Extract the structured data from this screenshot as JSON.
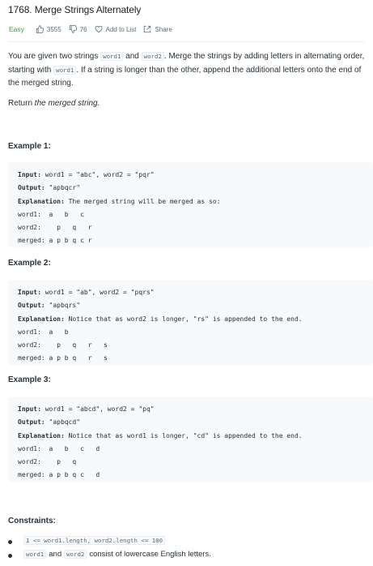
{
  "problem": {
    "title": "1768. Merge Strings Alternately",
    "difficulty": "Easy",
    "likes": "3555",
    "dislikes": "76",
    "add_to_list": "Add to List",
    "share": "Share"
  },
  "description": {
    "p1_a": "You are given two strings ",
    "p1_code1": "word1",
    "p1_b": " and ",
    "p1_code2": "word2",
    "p1_c": ". Merge the strings by adding letters in alternating order, starting with ",
    "p1_code3": "word1",
    "p1_d": ". If a string is longer than the other, append the additional letters onto the end of the merged string.",
    "p2_a": "Return ",
    "p2_em": "the merged string."
  },
  "examples": [
    {
      "title": "Example 1:",
      "input_label": "Input:",
      "input": " word1 = \"abc\", word2 = \"pqr\"",
      "output_label": "Output:",
      "output": " \"apbqcr\"",
      "explanation_label": "Explanation:",
      "explanation": " The merged string will be merged as so:",
      "word1_line": "word1:  a   b   c",
      "word2_line": "word2:    p   q   r",
      "merged_line": "merged: a p b q c r"
    },
    {
      "title": "Example 2:",
      "input_label": "Input:",
      "input": " word1 = \"ab\", word2 = \"pqrs\"",
      "output_label": "Output:",
      "output": " \"apbqrs\"",
      "explanation_label": "Explanation:",
      "explanation": " Notice that as word2 is longer, \"rs\" is appended to the end.",
      "word1_line": "word1:  a   b",
      "word2_line": "word2:    p   q   r   s",
      "merged_line": "merged: a p b q   r   s"
    },
    {
      "title": "Example 3:",
      "input_label": "Input:",
      "input": " word1 = \"abcd\", word2 = \"pq\"",
      "output_label": "Output:",
      "output": " \"apbqcd\"",
      "explanation_label": "Explanation:",
      "explanation": " Notice that as word1 is longer, \"cd\" is appended to the end.",
      "word1_line": "word1:  a   b   c   d",
      "word2_line": "word2:    p   q",
      "merged_line": "merged: a p b q c   d"
    }
  ],
  "constraints": {
    "title": "Constraints:",
    "c1_code": "1 <= word1.length, word2.length <= 100",
    "c2_code1": "word1",
    "c2_mid": "and",
    "c2_code2": "word2",
    "c2_text": "consist of lowercase English letters."
  },
  "colors": {
    "easy": "#43a047",
    "meta": "#546e7a",
    "code_bg": "#f7f9fa"
  },
  "icons": [
    "thumbs-up-icon",
    "thumbs-down-icon",
    "heart-outline-icon",
    "share-icon"
  ]
}
